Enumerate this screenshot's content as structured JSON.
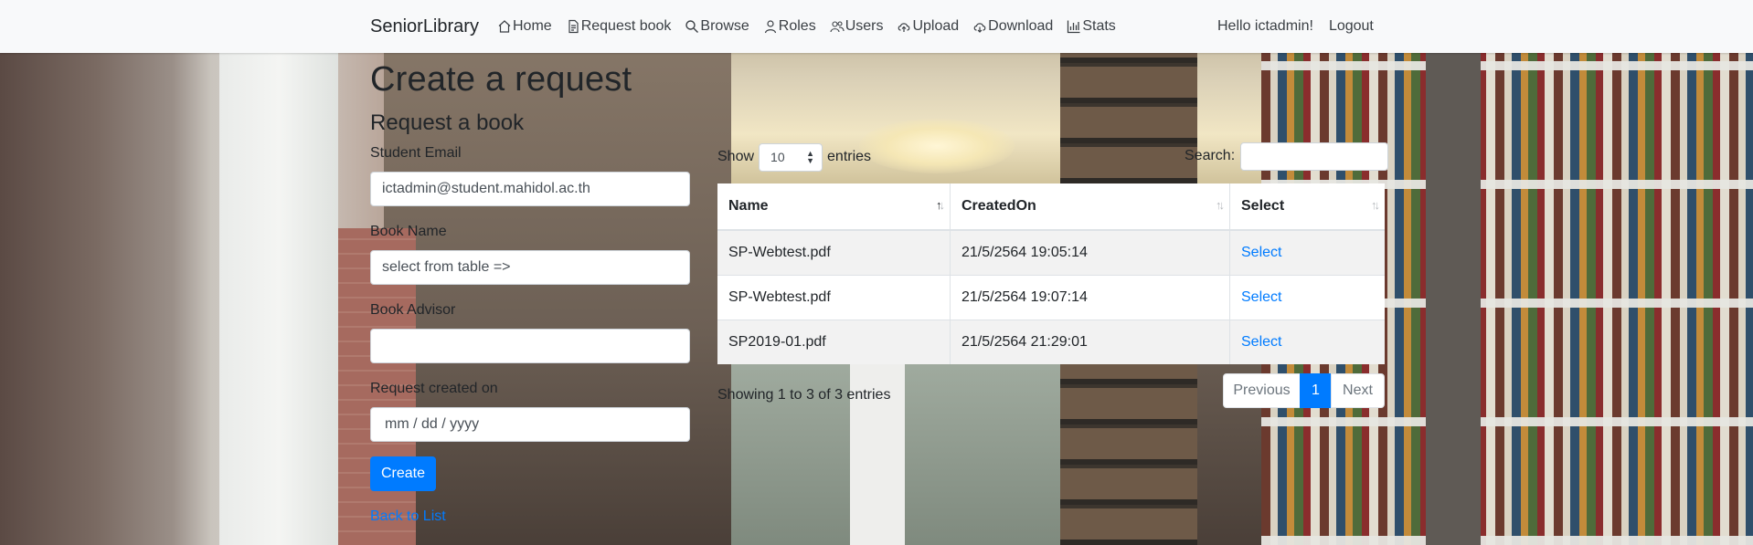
{
  "navbar": {
    "brand": "SeniorLibrary",
    "items": [
      {
        "label": "Home",
        "icon": "house-icon"
      },
      {
        "label": "Request book",
        "icon": "document-icon"
      },
      {
        "label": "Browse",
        "icon": "search-icon"
      },
      {
        "label": "Roles",
        "icon": "person-icon"
      },
      {
        "label": "Users",
        "icon": "people-icon"
      },
      {
        "label": "Upload",
        "icon": "cloud-upload-icon"
      },
      {
        "label": "Download",
        "icon": "cloud-download-icon"
      },
      {
        "label": "Stats",
        "icon": "bar-chart-icon"
      }
    ],
    "greeting": "Hello ictadmin!",
    "logout": "Logout"
  },
  "page": {
    "title": "Create a request",
    "subtitle": "Request a book"
  },
  "form": {
    "email_label": "Student Email",
    "email_value": "ictadmin@student.mahidol.ac.th",
    "book_label": "Book Name",
    "book_value": "select from table =>",
    "advisor_label": "Book Advisor",
    "advisor_value": "",
    "date_label": "Request created on",
    "date_placeholder": "mm / dd / yyyy",
    "create_button": "Create",
    "back_link": "Back to List"
  },
  "datatable": {
    "show_label": "Show",
    "length_value": "10",
    "entries_label": "entries",
    "search_label": "Search:",
    "columns": [
      "Name",
      "CreatedOn",
      "Select"
    ],
    "rows": [
      {
        "name": "SP-Webtest.pdf",
        "created": "21/5/2564 19:05:14",
        "action": "Select"
      },
      {
        "name": "SP-Webtest.pdf",
        "created": "21/5/2564 19:07:14",
        "action": "Select"
      },
      {
        "name": "SP2019-01.pdf",
        "created": "21/5/2564 21:29:01",
        "action": "Select"
      }
    ],
    "info": "Showing 1 to 3 of 3 entries",
    "pagination": {
      "previous": "Previous",
      "current": "1",
      "next": "Next"
    }
  },
  "colors": {
    "primary": "#007bff",
    "navbar_bg": "#f8f9fa",
    "text": "#212529"
  }
}
